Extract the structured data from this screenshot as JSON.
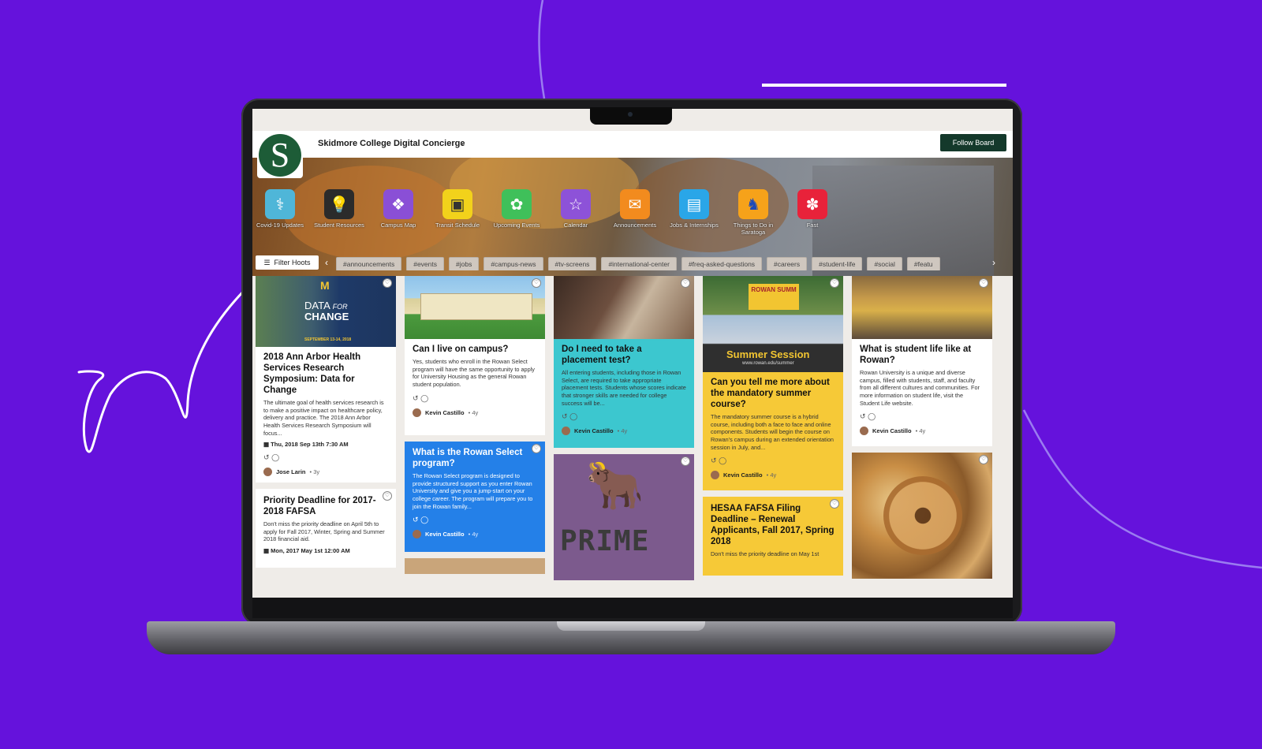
{
  "board": {
    "logo_letter": "S",
    "title": "Skidmore College Digital Concierge",
    "follow_label": "Follow Board"
  },
  "apps": [
    {
      "label": "Covid-19 Updates",
      "icon": "doctor-mask-icon",
      "color": "#4fb6d8"
    },
    {
      "label": "Student Resources",
      "icon": "lightbulb-icon",
      "color": "#2b2b2b"
    },
    {
      "label": "Campus Map",
      "icon": "map-icon",
      "color": "#8a4fd6"
    },
    {
      "label": "Transit Schedule",
      "icon": "bus-icon",
      "color": "#f2d21b"
    },
    {
      "label": "Upcoming Events",
      "icon": "leaf-icon",
      "color": "#3fc05a"
    },
    {
      "label": "Calendar",
      "icon": "calendar-icon",
      "color": "#8d52d8"
    },
    {
      "label": "Announcements",
      "icon": "chat-bubbles-icon",
      "color": "#f28b1e"
    },
    {
      "label": "Jobs & Internships",
      "icon": "document-icon",
      "color": "#2aa6e8"
    },
    {
      "label": "Things to Do in Saratoga",
      "icon": "horse-icon",
      "color": "#f6a21a"
    },
    {
      "label": "Fast",
      "icon": "yelp-icon",
      "color": "#e8223a"
    }
  ],
  "filter_label": "Filter Hoots",
  "tags": [
    "#announcements",
    "#events",
    "#jobs",
    "#campus-news",
    "#tv-screens",
    "#international-center",
    "#freq-asked-questions",
    "#careers",
    "#student-life",
    "#social",
    "#featu"
  ],
  "cards": {
    "c1": {
      "img_title_top": "DATA",
      "img_title_for": "FOR",
      "img_title_bottom": "CHANGE",
      "img_caption": "SEPTEMBER 13-14, 2018",
      "title": "2018 Ann Arbor Health Services Research Symposium: Data for Change",
      "text": "The ultimate goal of health services research is to make a positive impact on healthcare policy, delivery and practice. The 2018 Ann Arbor Health Services Research Symposium will focus...",
      "date": "Thu, 2018 Sep 13th 7:30 AM",
      "author": "Jose Larin",
      "age": "3y"
    },
    "c2": {
      "title": "Priority Deadline for 2017-2018 FAFSA",
      "text": "Don't miss the priority deadline on April 5th to apply for Fall 2017, Winter, Spring and Summer 2018 financial aid.",
      "date": "Mon, 2017 May 1st 12:00 AM"
    },
    "c3": {
      "title": "Can I live on campus?",
      "text": "Yes, students who enroll in the Rowan Select program will have the same opportunity to apply for University Housing as the general Rowan student population.",
      "author": "Kevin Castillo",
      "age": "4y"
    },
    "c4": {
      "title": "What is the Rowan Select program?",
      "text": "The Rowan Select program is designed to provide structured support as you enter Rowan University and give you a jump-start on your college career. The program will prepare you to join the Rowan family...",
      "author": "Kevin Castillo",
      "age": "4y"
    },
    "c5": {
      "title": "Do I need to take a placement test?",
      "text": "All entering students, including those in Rowan Select, are required to take appropriate placement tests. Students whose scores indicate that stronger skills are needed for college success will be...",
      "author": "Kevin Castillo",
      "age": "4y"
    },
    "c6": {
      "img_text": "PRIME"
    },
    "c7": {
      "img_banner": "Summer Session",
      "img_url": "www.rowan.edu/summer",
      "img_sign": "ROWAN SUMM",
      "title": "Can you tell me more about the mandatory summer course?",
      "text": "The mandatory summer course is a hybrid course, including both a face to face and online components. Students will begin the course on Rowan's campus during an extended orientation session in July, and...",
      "author": "Kevin Castillo",
      "age": "4y"
    },
    "c8": {
      "title": "HESAA FAFSA Filing Deadline – Renewal Applicants, Fall 2017, Spring 2018",
      "text": "Don't miss the priority deadline on May 1st"
    },
    "c9": {
      "title": "What is student life like at Rowan?",
      "text": "Rowan University is a unique and diverse campus, filled with students, staff, and faculty from all different cultures and communities. For more information on student life, visit the Student Life website.",
      "author": "Kevin Castillo",
      "age": "4y"
    }
  },
  "colors": {
    "background": "#6512dc",
    "follow_button": "#14392b",
    "logo_green": "#1d5c37",
    "card_blue": "#2480e8",
    "card_cyan": "#3cc7cf",
    "card_yellow": "#f6c937"
  }
}
